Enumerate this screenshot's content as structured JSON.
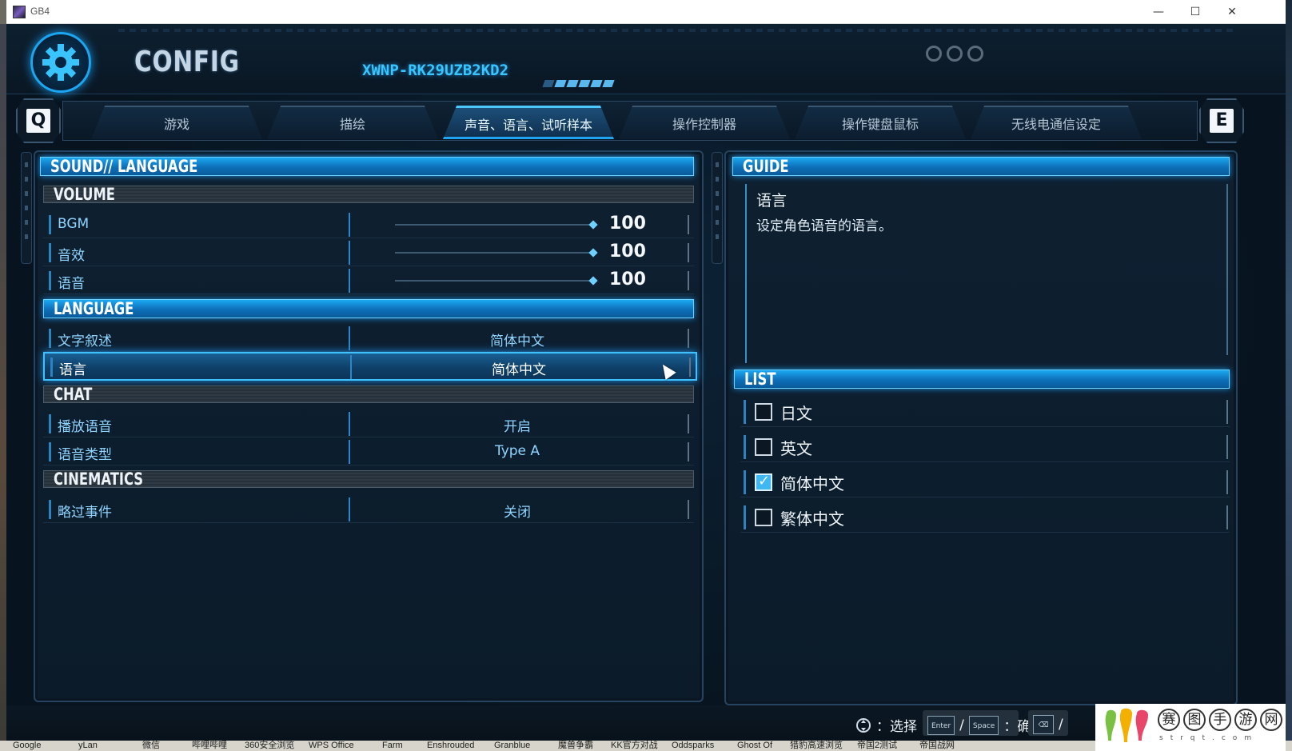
{
  "window": {
    "title": "GB4",
    "minimize": "—",
    "maximize": "☐",
    "close": "✕"
  },
  "header": {
    "title": "CONFIG",
    "user_id": "XWNP-RK29UZB2KD2"
  },
  "tabs": {
    "q": "Q",
    "e": "E",
    "items": [
      "游戏",
      "描绘",
      "声音、语言、试听样本",
      "操作控制器",
      "操作键盘鼠标",
      "无线电通信设定"
    ],
    "active_index": 2
  },
  "left": {
    "section_title": "SOUND// LANGUAGE",
    "volume": {
      "title": "VOLUME",
      "rows": [
        {
          "label": "BGM",
          "value": "100",
          "level": 1.0
        },
        {
          "label": "音效",
          "value": "100",
          "level": 1.0
        },
        {
          "label": "语音",
          "value": "100",
          "level": 1.0
        }
      ]
    },
    "language": {
      "title": "LANGUAGE",
      "rows": [
        {
          "label": "文字叙述",
          "value": "简体中文"
        },
        {
          "label": "语言",
          "value": "简体中文",
          "selected": true
        }
      ]
    },
    "chat": {
      "title": "CHAT",
      "rows": [
        {
          "label": "播放语音",
          "value": "开启"
        },
        {
          "label": "语音类型",
          "value": "Type A"
        }
      ]
    },
    "cinematics": {
      "title": "CINEMATICS",
      "rows": [
        {
          "label": "略过事件",
          "value": "关闭"
        }
      ]
    }
  },
  "guide": {
    "title": "GUIDE",
    "heading": "语言",
    "text": "设定角色语音的语言。"
  },
  "list": {
    "title": "LIST",
    "options": [
      {
        "label": "日文",
        "checked": false
      },
      {
        "label": "英文",
        "checked": false
      },
      {
        "label": "简体中文",
        "checked": true
      },
      {
        "label": "繁体中文",
        "checked": false
      }
    ]
  },
  "footer": {
    "select_label": "：选择",
    "confirm_label": "：确定",
    "enter_key": "Enter",
    "space_key": "Space",
    "slash": "/",
    "back_key": "⌫"
  },
  "taskbar": [
    "Google",
    "yLan",
    "微信",
    "哔哩哔哩",
    "360安全浏览",
    "WPS Office",
    "Farm",
    "Enshrouded",
    "Granblue",
    "魔兽争霸",
    "KK官方对战",
    "Oddsparks",
    "Ghost Of",
    "猎豹高速浏览",
    "帝国2测试",
    "帝国战网"
  ],
  "watermark": {
    "chars": [
      "赛",
      "图",
      "手",
      "游",
      "网"
    ],
    "sub": "strqt.com"
  },
  "colors": {
    "accent": "#1ca8f2",
    "bg": "#0b1b2a",
    "label": "#8fd4ff"
  }
}
